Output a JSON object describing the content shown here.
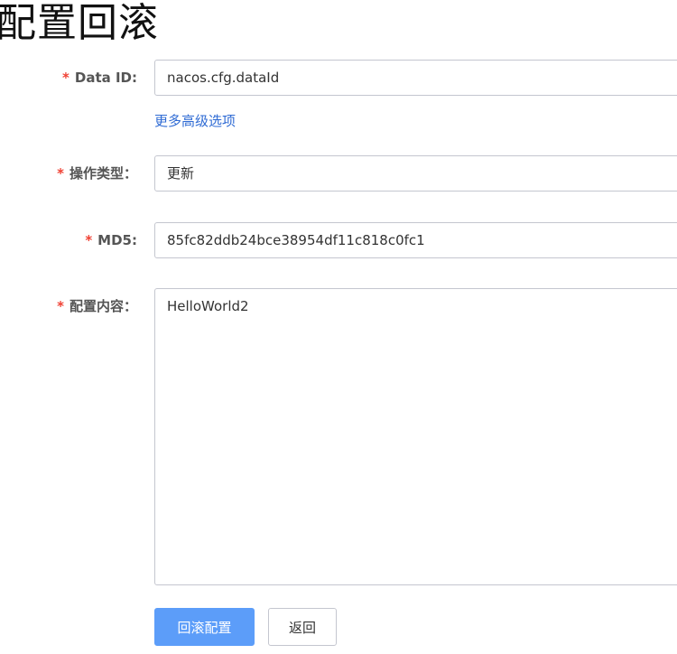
{
  "page": {
    "title": "配置回滚"
  },
  "form": {
    "required_mark": "*",
    "data_id": {
      "label": "Data ID:",
      "value": "nacos.cfg.dataId"
    },
    "advanced_link": "更多高级选项",
    "operation_type": {
      "label": "操作类型：",
      "value": "更新"
    },
    "md5": {
      "label": "MD5:",
      "value": "85fc82ddb24bce38954df11c818c0fc1"
    },
    "content": {
      "label": "配置内容：",
      "value": "HelloWorld2"
    }
  },
  "actions": {
    "rollback_label": "回滚配置",
    "back_label": "返回"
  },
  "colors": {
    "required": "#f04134",
    "link": "#2f6bd4",
    "primary": "#5c9df9",
    "border": "#c4c6cf"
  }
}
